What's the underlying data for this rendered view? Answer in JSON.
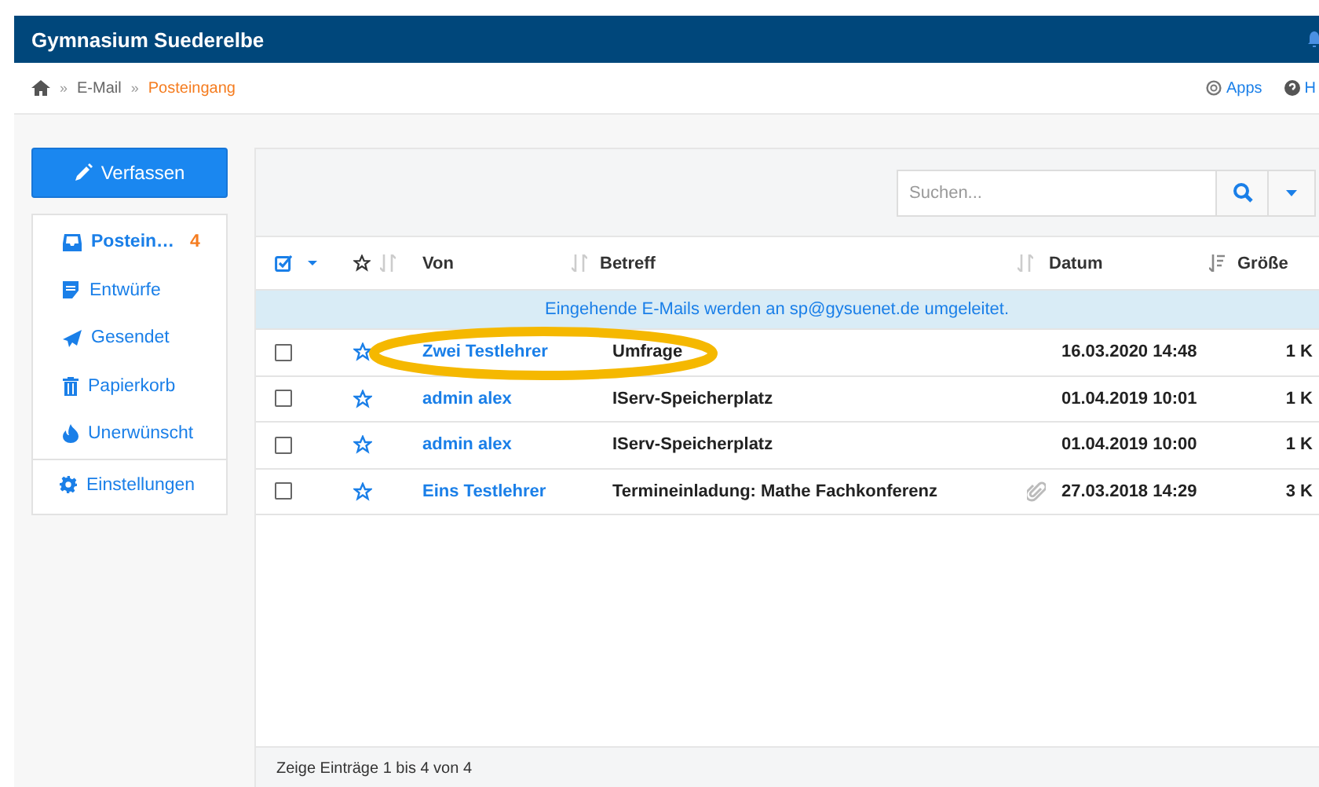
{
  "header": {
    "title": "Gymnasium Suederelbe"
  },
  "breadcrumb": [
    {
      "separator": "»",
      "label": "E-Mail",
      "current": false
    },
    {
      "separator": "»",
      "label": "Posteingang",
      "current": true
    }
  ],
  "top_links": [
    {
      "kind": "apps",
      "label": "Apps"
    },
    {
      "kind": "help",
      "label": "H"
    }
  ],
  "compose_button": "Verfassen",
  "folders": [
    {
      "kind": "inbox",
      "label": "Postein…",
      "count": "4",
      "selected": true
    },
    {
      "kind": "drafts",
      "label": "Entwürfe",
      "selected": false
    },
    {
      "kind": "sent",
      "label": "Gesendet",
      "selected": false
    },
    {
      "kind": "trash",
      "label": "Papierkorb",
      "selected": false
    },
    {
      "kind": "spam",
      "label": "Unerwünscht",
      "selected": false
    }
  ],
  "settings_link": "Einstellungen",
  "search": {
    "placeholder": "Suchen..."
  },
  "table": {
    "columns": [
      "Von",
      "Betreff",
      "Datum",
      "Größe"
    ],
    "notice": "Eingehende E-Mails werden an sp@gysuenet.de umgeleitet.",
    "rows": [
      {
        "checked": false,
        "starred": false,
        "from": "Zwei Testlehrer",
        "subject": "Umfrage",
        "attachment": false,
        "date": "16.03.2020 14:48",
        "size": "1 K"
      },
      {
        "checked": false,
        "starred": false,
        "from": "admin alex",
        "subject": "IServ-Speicherplatz",
        "attachment": false,
        "date": "01.04.2019 10:01",
        "size": "1 K"
      },
      {
        "checked": false,
        "starred": false,
        "from": "admin alex",
        "subject": "IServ-Speicherplatz",
        "attachment": false,
        "date": "01.04.2019 10:00",
        "size": "1 K"
      },
      {
        "checked": false,
        "starred": false,
        "from": "Eins Testlehrer",
        "subject": "Termineinladung: Mathe Fachkonferenz",
        "attachment": true,
        "date": "27.03.2018 14:29",
        "size": "3 K"
      }
    ]
  },
  "footer": "Zeige Einträge 1 bis 4 von 4",
  "annotation": {
    "kind": "ellipse",
    "color": "#f5b800"
  }
}
